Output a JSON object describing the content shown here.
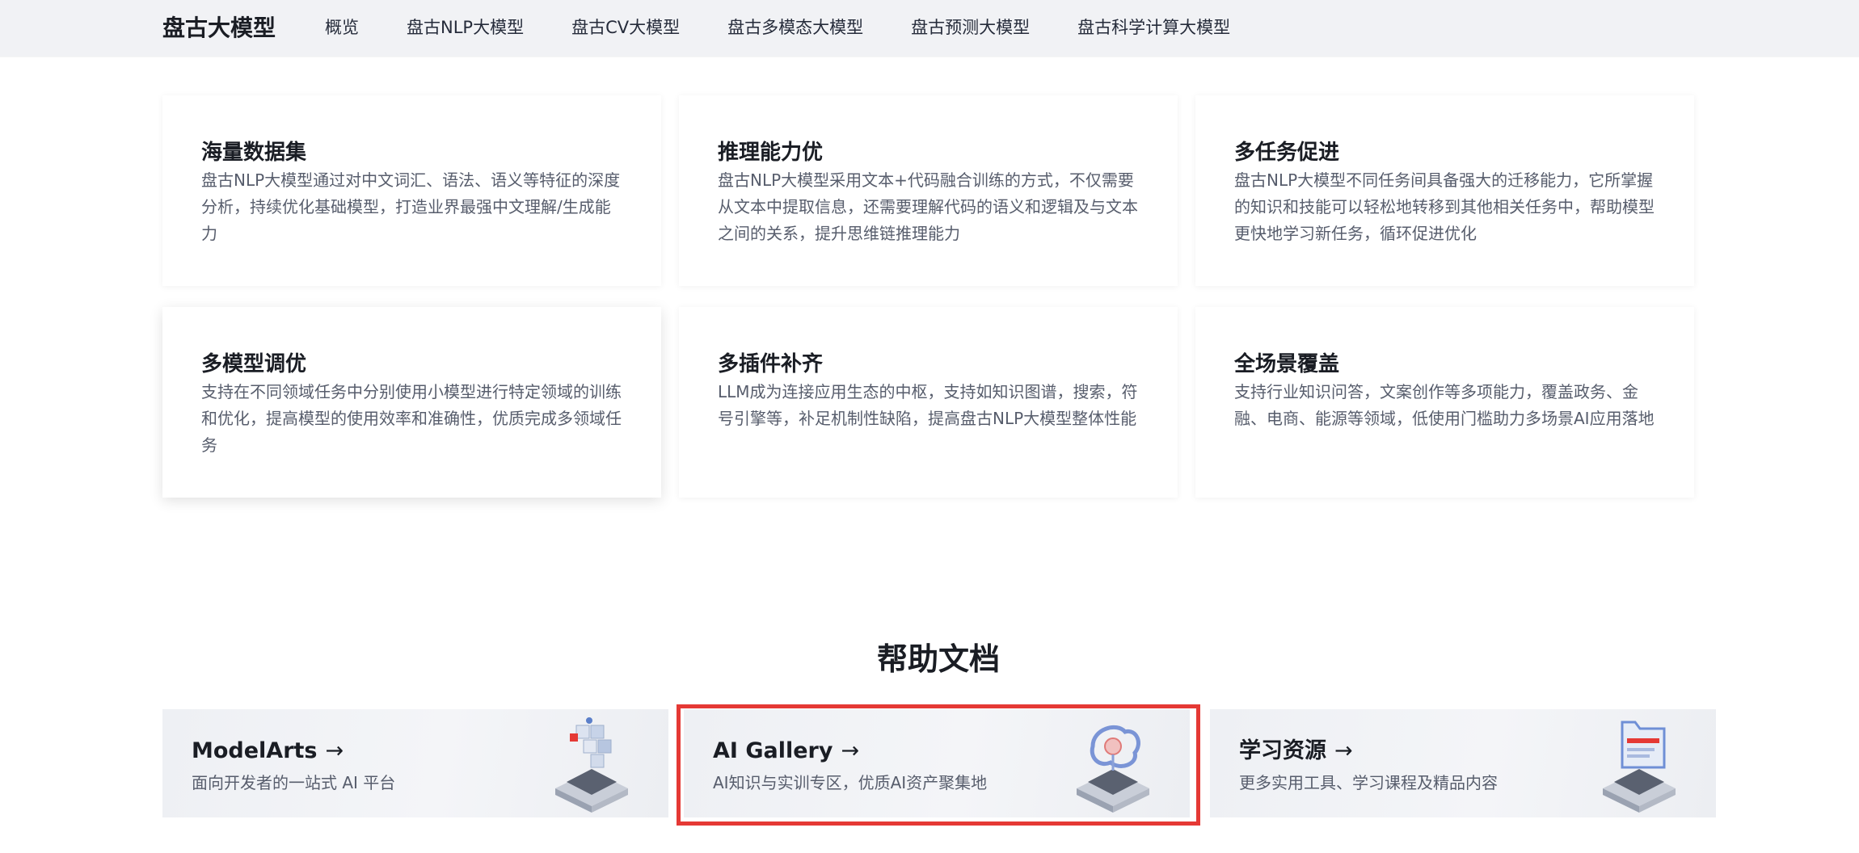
{
  "nav": {
    "brand": "盘古大模型",
    "links": [
      "概览",
      "盘古NLP大模型",
      "盘古CV大模型",
      "盘古多模态大模型",
      "盘古预测大模型",
      "盘古科学计算大模型"
    ]
  },
  "features": [
    {
      "title": "海量数据集",
      "desc": "盘古NLP大模型通过对中文词汇、语法、语义等特征的深度分析，持续优化基础模型，打造业界最强中文理解/生成能力"
    },
    {
      "title": "推理能力优",
      "desc": "盘古NLP大模型采用文本+代码融合训练的方式，不仅需要从文本中提取信息，还需要理解代码的语义和逻辑及与文本之间的关系，提升思维链推理能力"
    },
    {
      "title": "多任务促进",
      "desc": "盘古NLP大模型不同任务间具备强大的迁移能力，它所掌握的知识和技能可以轻松地转移到其他相关任务中，帮助模型更快地学习新任务，循环促进优化"
    },
    {
      "title": "多模型调优",
      "desc": "支持在不同领域任务中分别使用小模型进行特定领域的训练和优化，提高模型的使用效率和准确性，优质完成多领域任务"
    },
    {
      "title": "多插件补齐",
      "desc": "LLM成为连接应用生态的中枢，支持如知识图谱，搜索，符号引擎等，补足机制性缺陷，提高盘古NLP大模型整体性能"
    },
    {
      "title": "全场景覆盖",
      "desc": "支持行业知识问答，文案创作等多项能力，覆盖政务、金融、电商、能源等领域，低使用门槛助力多场景AI应用落地"
    }
  ],
  "help": {
    "heading": "帮助文档",
    "arrow": "→",
    "cards": [
      {
        "title": "ModelArts",
        "desc": "面向开发者的一站式 AI 平台"
      },
      {
        "title": "AI Gallery",
        "desc": "AI知识与实训专区，优质AI资产聚集地"
      },
      {
        "title": "学习资源",
        "desc": "更多实用工具、学习课程及精品内容"
      }
    ]
  },
  "colors": {
    "highlight_border": "#e53935",
    "nav_bg": "#f1f2f5"
  }
}
